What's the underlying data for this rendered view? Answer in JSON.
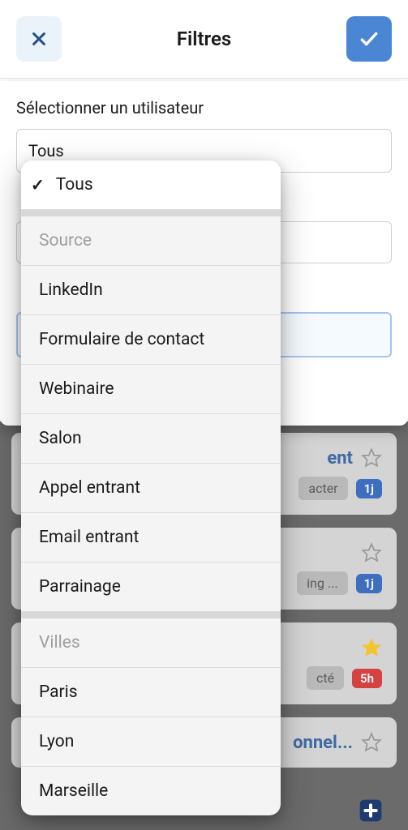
{
  "header": {
    "title": "Filtres"
  },
  "form": {
    "user_label": "Sélectionner un utilisateur",
    "user_value": "Tous"
  },
  "dropdown": {
    "selected": "Tous",
    "section1_label": "Source",
    "section1_items": [
      "LinkedIn",
      "Formulaire de contact",
      "Webinaire",
      "Salon",
      "Appel entrant",
      "Email entrant",
      "Parrainage"
    ],
    "section2_label": "Villes",
    "section2_items": [
      "Paris",
      "Lyon",
      "Marseille"
    ]
  },
  "bg": {
    "card1_title_suffix": "ent",
    "card1_tag_suffix": "acter",
    "card1_badge": "1j",
    "card2_tag_suffix": "ing ...",
    "card2_badge": "1j",
    "card3_tag_suffix": "cté",
    "card3_badge": "5h",
    "card4_title_suffix": "onnel..."
  }
}
